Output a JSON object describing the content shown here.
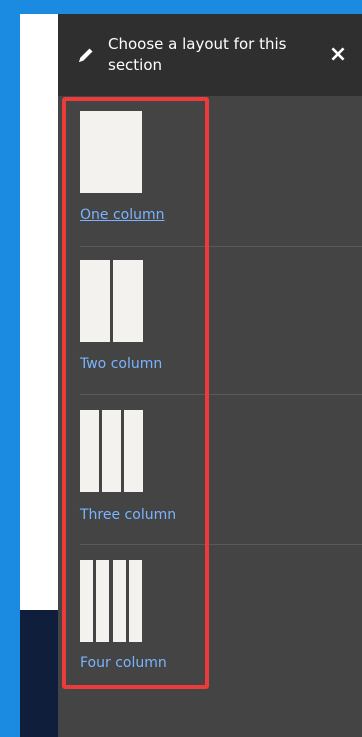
{
  "panel": {
    "title": "Choose a layout for this section",
    "close_label": "×"
  },
  "layouts": [
    {
      "label": "One column",
      "columns": 1
    },
    {
      "label": "Two column",
      "columns": 2
    },
    {
      "label": "Three column",
      "columns": 3
    },
    {
      "label": "Four column",
      "columns": 4
    }
  ],
  "colors": {
    "panel_bg": "#444444",
    "header_bg": "#2f2f2f",
    "link": "#7ab4ff",
    "thumb": "#f3f2ee",
    "highlight": "#ec3b3b",
    "frame_blue": "#1a8be0"
  }
}
